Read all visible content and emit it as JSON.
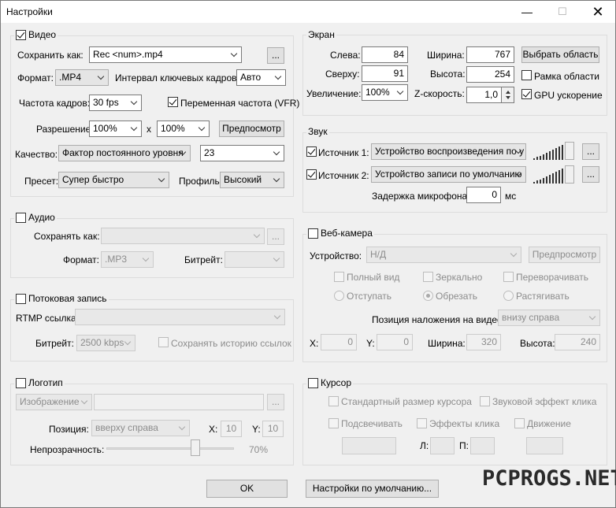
{
  "window": {
    "title": "Настройки"
  },
  "video": {
    "label": "Видео",
    "save_as_label": "Сохранить как:",
    "save_as_value": "Rec <num>.mp4",
    "browse": "...",
    "format_label": "Формат:",
    "format_value": ".MP4",
    "keyframe_label": "Интервал ключевых кадров:",
    "keyframe_value": "Авто",
    "fps_label": "Частота кадров:",
    "fps_value": "30 fps",
    "vfr_label": "Переменная частота (VFR)",
    "res_label": "Разрешение:",
    "res_w": "100%",
    "res_x": "x",
    "res_h": "100%",
    "preview": "Предпосмотр",
    "quality_label": "Качество:",
    "quality_value": "Фактор постоянного уровня",
    "quality_num": "23",
    "preset_label": "Пресет:",
    "preset_value": "Супер быстро",
    "profile_label": "Профиль:",
    "profile_value": "Высокий"
  },
  "audio": {
    "label": "Аудио",
    "save_as_label": "Сохранять как:",
    "browse": "...",
    "format_label": "Формат:",
    "format_value": ".MP3",
    "bitrate_label": "Битрейт:"
  },
  "stream": {
    "label": "Потоковая запись",
    "rtmp_label": "RTMP ссылка:",
    "bitrate_label": "Битрейт:",
    "bitrate_value": "2500 kbps",
    "history_label": "Сохранять историю ссылок"
  },
  "logo": {
    "label": "Логотип",
    "type_value": "Изображение",
    "browse": "...",
    "pos_label": "Позиция:",
    "pos_value": "вверху справа",
    "x_label": "X:",
    "x_value": "10",
    "y_label": "Y:",
    "y_value": "10",
    "opacity_label": "Непрозрачность:",
    "opacity_value": "70%",
    "opacity_level": 0.7
  },
  "screen": {
    "label": "Экран",
    "left_label": "Слева:",
    "left_value": "84",
    "top_label": "Сверху:",
    "top_value": "91",
    "width_label": "Ширина:",
    "width_value": "767",
    "height_label": "Высота:",
    "height_value": "254",
    "select_area": "Выбрать область",
    "frame_label": "Рамка области",
    "zoom_label": "Увеличение:",
    "zoom_value": "100%",
    "zspeed_label": "Z-скорость:",
    "zspeed_value": "1,0",
    "gpu_label": "GPU ускорение"
  },
  "sound": {
    "label": "Звук",
    "src1_label": "Источник 1:",
    "src1_value": "Устройство воспроизведения по у",
    "src2_label": "Источник 2:",
    "src2_value": "Устройство записи по умолчанию",
    "browse": "...",
    "mic_delay_label": "Задержка микрофона:",
    "mic_delay_value": "0",
    "mic_delay_unit": "мс"
  },
  "webcam": {
    "label": "Веб-камера",
    "device_label": "Устройство:",
    "device_value": "Н/Д",
    "preview": "Предпросмотр",
    "full_view": "Полный вид",
    "mirror": "Зеркально",
    "flip": "Переворачивать",
    "indent": "Отступать",
    "crop": "Обрезать",
    "stretch": "Растягивать",
    "overlay_label": "Позиция наложения на видео:",
    "overlay_value": "внизу справа",
    "x_label": "X:",
    "x_value": "0",
    "y_label": "Y:",
    "y_value": "0",
    "w_label": "Ширина:",
    "w_value": "320",
    "h_label": "Высота:",
    "h_value": "240"
  },
  "cursor": {
    "label": "Курсор",
    "std_size": "Стандартный размер курсора",
    "click_sound": "Звуковой эффект клика",
    "highlight": "Подсвечивать",
    "click_fx": "Эффекты клика",
    "movement": "Движение",
    "l_label": "Л:",
    "r_label": "П:"
  },
  "footer": {
    "ok": "OK",
    "defaults": "Настройки по умолчанию..."
  },
  "watermark": "PCPROGS.NET"
}
